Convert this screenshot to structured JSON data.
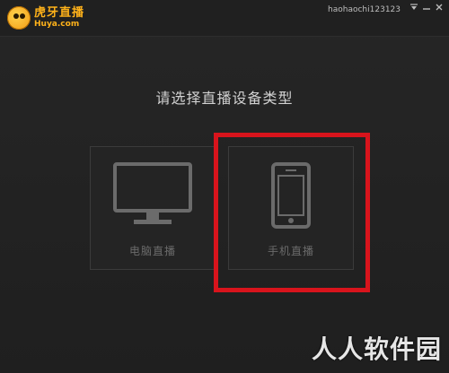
{
  "titlebar": {
    "logo_cn": "虎牙直播",
    "logo_en": "Huya.com",
    "username": "haohaochi123123",
    "menu_icon": "menu-icon",
    "min_icon": "minimize-icon",
    "close_icon": "close-icon"
  },
  "main": {
    "heading": "请选择直播设备类型",
    "options": [
      {
        "label": "电脑直播",
        "icon": "monitor-icon"
      },
      {
        "label": "手机直播",
        "icon": "phone-icon"
      }
    ]
  },
  "watermark": "人人软件园",
  "colors": {
    "background": "#232323",
    "accent": "#ffb21a",
    "highlight": "#d8141c",
    "card_border": "#3b3b3b",
    "icon": "#6b6b6b"
  }
}
